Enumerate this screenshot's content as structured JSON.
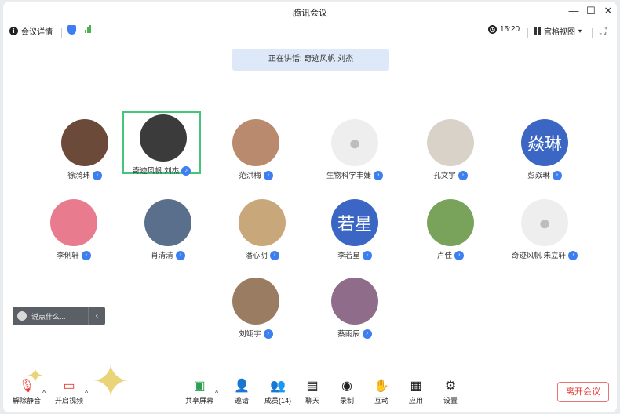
{
  "window": {
    "title": "腾讯会议"
  },
  "toolbar": {
    "meeting_details": "会议详情",
    "time": "15:20",
    "view_mode": "宫格视图"
  },
  "banner": {
    "speaking": "正在讲话: 奇迹风帆 刘杰"
  },
  "participants": [
    {
      "name": "徐漪玮",
      "avatar_color": "#6b4a3a"
    },
    {
      "name": "奇迹风帆 刘杰",
      "avatar_color": "#3b3b3b"
    },
    {
      "name": "范洪梅",
      "avatar_color": "#b98a6e"
    },
    {
      "name": "生物科学丰婕",
      "avatar_color": "#eeeeee"
    },
    {
      "name": "孔文宇",
      "avatar_color": "#d9d2c9"
    },
    {
      "name": "彭焱琳",
      "avatar_text": "焱琳",
      "avatar_color": "#3b66c4"
    },
    {
      "name": "李俐轩",
      "avatar_color": "#e97b8f"
    },
    {
      "name": "肖清清",
      "avatar_color": "#5a6f8c"
    },
    {
      "name": "潘心明",
      "avatar_color": "#c8a87b"
    },
    {
      "name": "李若星",
      "avatar_text": "若星",
      "avatar_color": "#3b66c4"
    },
    {
      "name": "卢佳",
      "avatar_color": "#79a35a"
    },
    {
      "name": "奇迹风帆 朱立轩",
      "avatar_color": "#eeeeee"
    },
    {
      "name": "刘翊宇",
      "avatar_color": "#9a7c63"
    },
    {
      "name": "蔡雨辰",
      "avatar_color": "#8e6c8a"
    }
  ],
  "chat": {
    "placeholder": "说点什么..."
  },
  "bottom_bar": {
    "mute": "解除静音",
    "video": "开启视频",
    "share": "共享屏幕",
    "invite": "邀请",
    "members": "成员(14)",
    "chat": "聊天",
    "record": "录制",
    "reactions": "互动",
    "apps": "应用",
    "settings": "设置",
    "leave": "离开会议"
  },
  "colors": {
    "accent": "#3d7ff0",
    "active_border": "#46c47a",
    "leave": "#e53935"
  }
}
